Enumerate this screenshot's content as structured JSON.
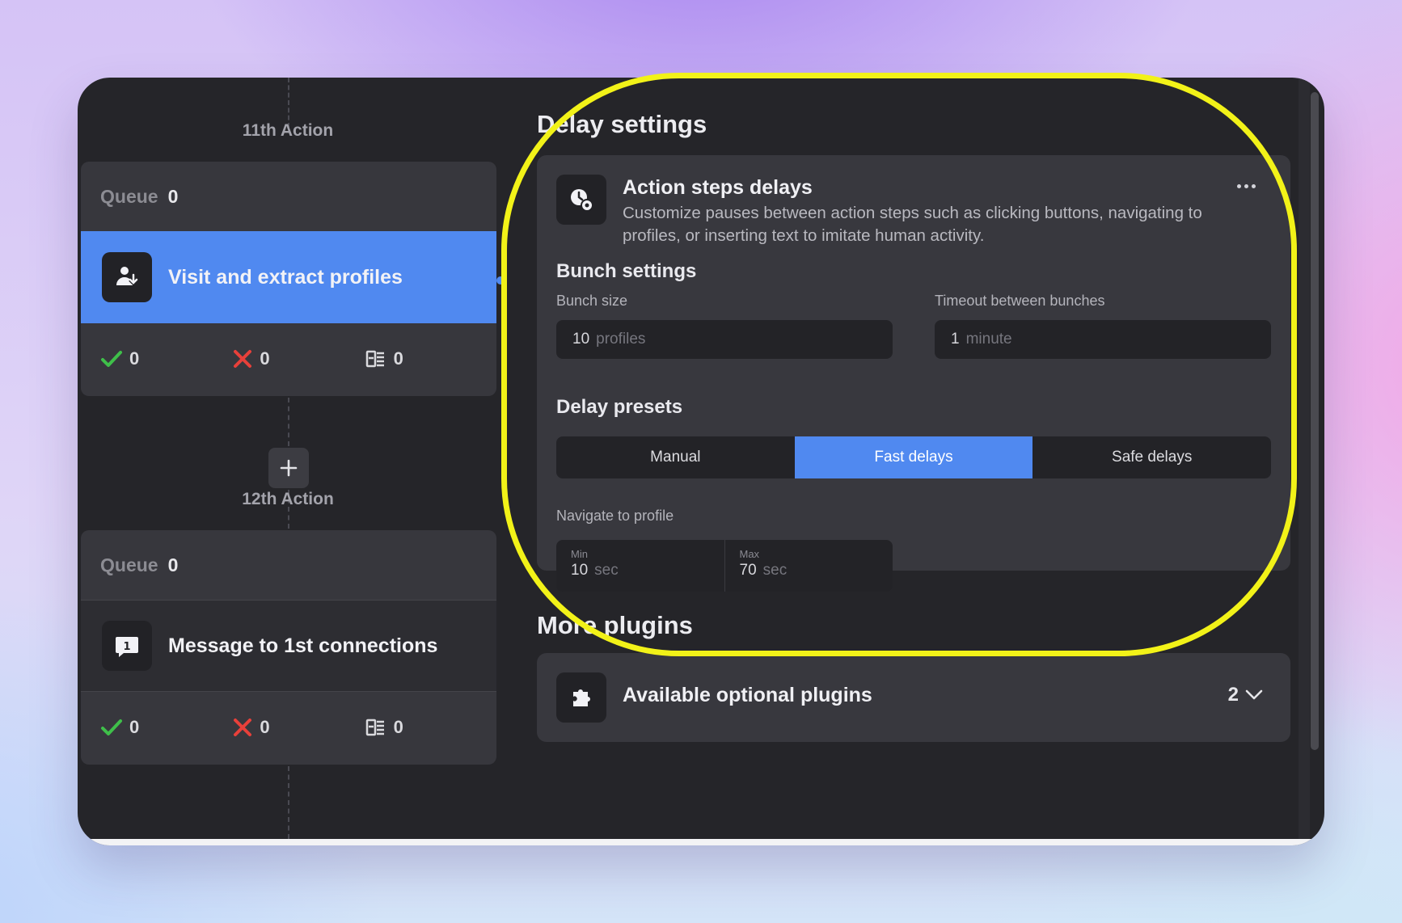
{
  "left": {
    "actions": [
      {
        "label": "11th Action",
        "queue_label": "Queue",
        "queue_count": "0",
        "title": "Visit and extract profiles",
        "icon": "user-download-icon",
        "active": true,
        "stats": {
          "success": "0",
          "failed": "0",
          "skipped": "0"
        }
      },
      {
        "label": "12th Action",
        "queue_label": "Queue",
        "queue_count": "0",
        "title": "Message to 1st connections",
        "icon": "message-user-icon",
        "active": false,
        "stats": {
          "success": "0",
          "failed": "0",
          "skipped": "0"
        }
      }
    ],
    "add_button_icon": "plus-icon"
  },
  "delay_settings": {
    "section_title": "Delay settings",
    "header": {
      "icon": "clock-gear-icon",
      "title": "Action steps delays",
      "description": "Customize pauses between action steps such as clicking buttons, navigating to profiles, or inserting text to imitate human activity."
    },
    "bunch": {
      "title": "Bunch settings",
      "size_label": "Bunch size",
      "size_value": "10",
      "size_unit": "profiles",
      "timeout_label": "Timeout between bunches",
      "timeout_value": "1",
      "timeout_unit": "minute"
    },
    "presets": {
      "title": "Delay presets",
      "options": [
        "Manual",
        "Fast delays",
        "Safe delays"
      ],
      "selected": "Fast delays"
    },
    "navigate": {
      "label": "Navigate to profile",
      "min_label": "Min",
      "min_value": "10",
      "max_label": "Max",
      "max_value": "70",
      "unit": "sec"
    }
  },
  "plugins": {
    "section_title": "More plugins",
    "icon": "puzzle-icon",
    "title": "Available optional plugins",
    "count": "2"
  },
  "colors": {
    "accent": "#5089f0",
    "highlight": "#f2f218",
    "success": "#3fbf4a",
    "danger": "#e8403a"
  }
}
